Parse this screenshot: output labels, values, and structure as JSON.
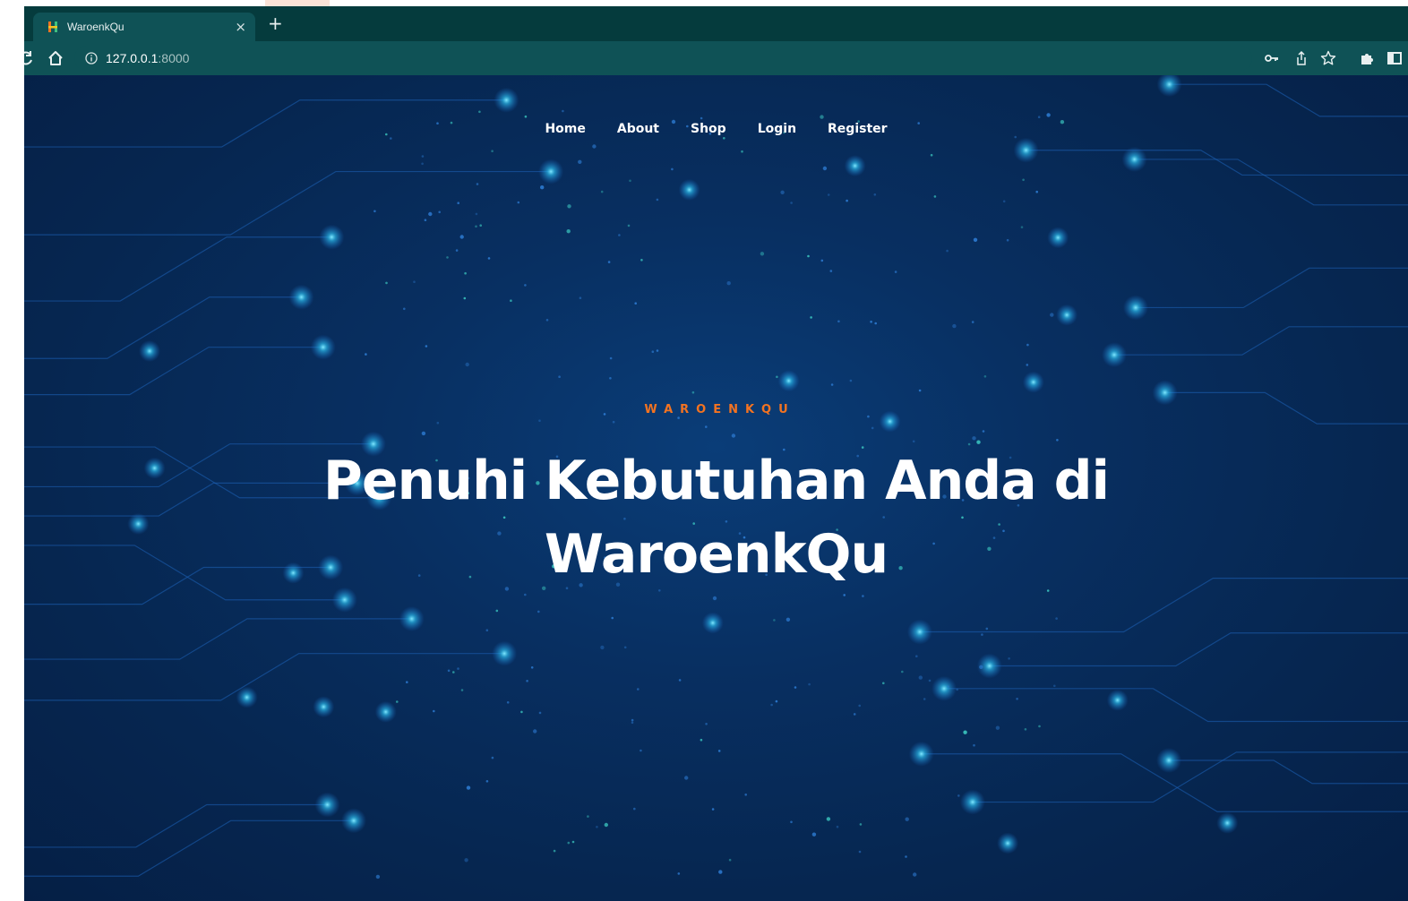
{
  "browser": {
    "tab_title": "WaroenkQu",
    "tab_favicon": "H",
    "close_glyph": "×",
    "new_tab_glyph": "+",
    "url_host": "127.0.0.1",
    "url_port": ":8000",
    "info_glyph": "ⓘ"
  },
  "nav": {
    "items": [
      {
        "label": "Home"
      },
      {
        "label": "About"
      },
      {
        "label": "Shop"
      },
      {
        "label": "Login"
      },
      {
        "label": "Register"
      }
    ]
  },
  "hero": {
    "kicker": "WAROENKQU",
    "headline_line1": "Penuhi Kebutuhan Anda di",
    "headline_line2": "WaroenkQu"
  },
  "colors": {
    "accent": "#f37321",
    "tab_bar": "#053b3d",
    "toolbar": "#0f5256",
    "page_background": "#082f61"
  },
  "icons": [
    "reload-icon",
    "home-icon",
    "info-icon",
    "key-icon",
    "share-icon",
    "star-icon",
    "extensions-icon",
    "side-panel-icon"
  ]
}
